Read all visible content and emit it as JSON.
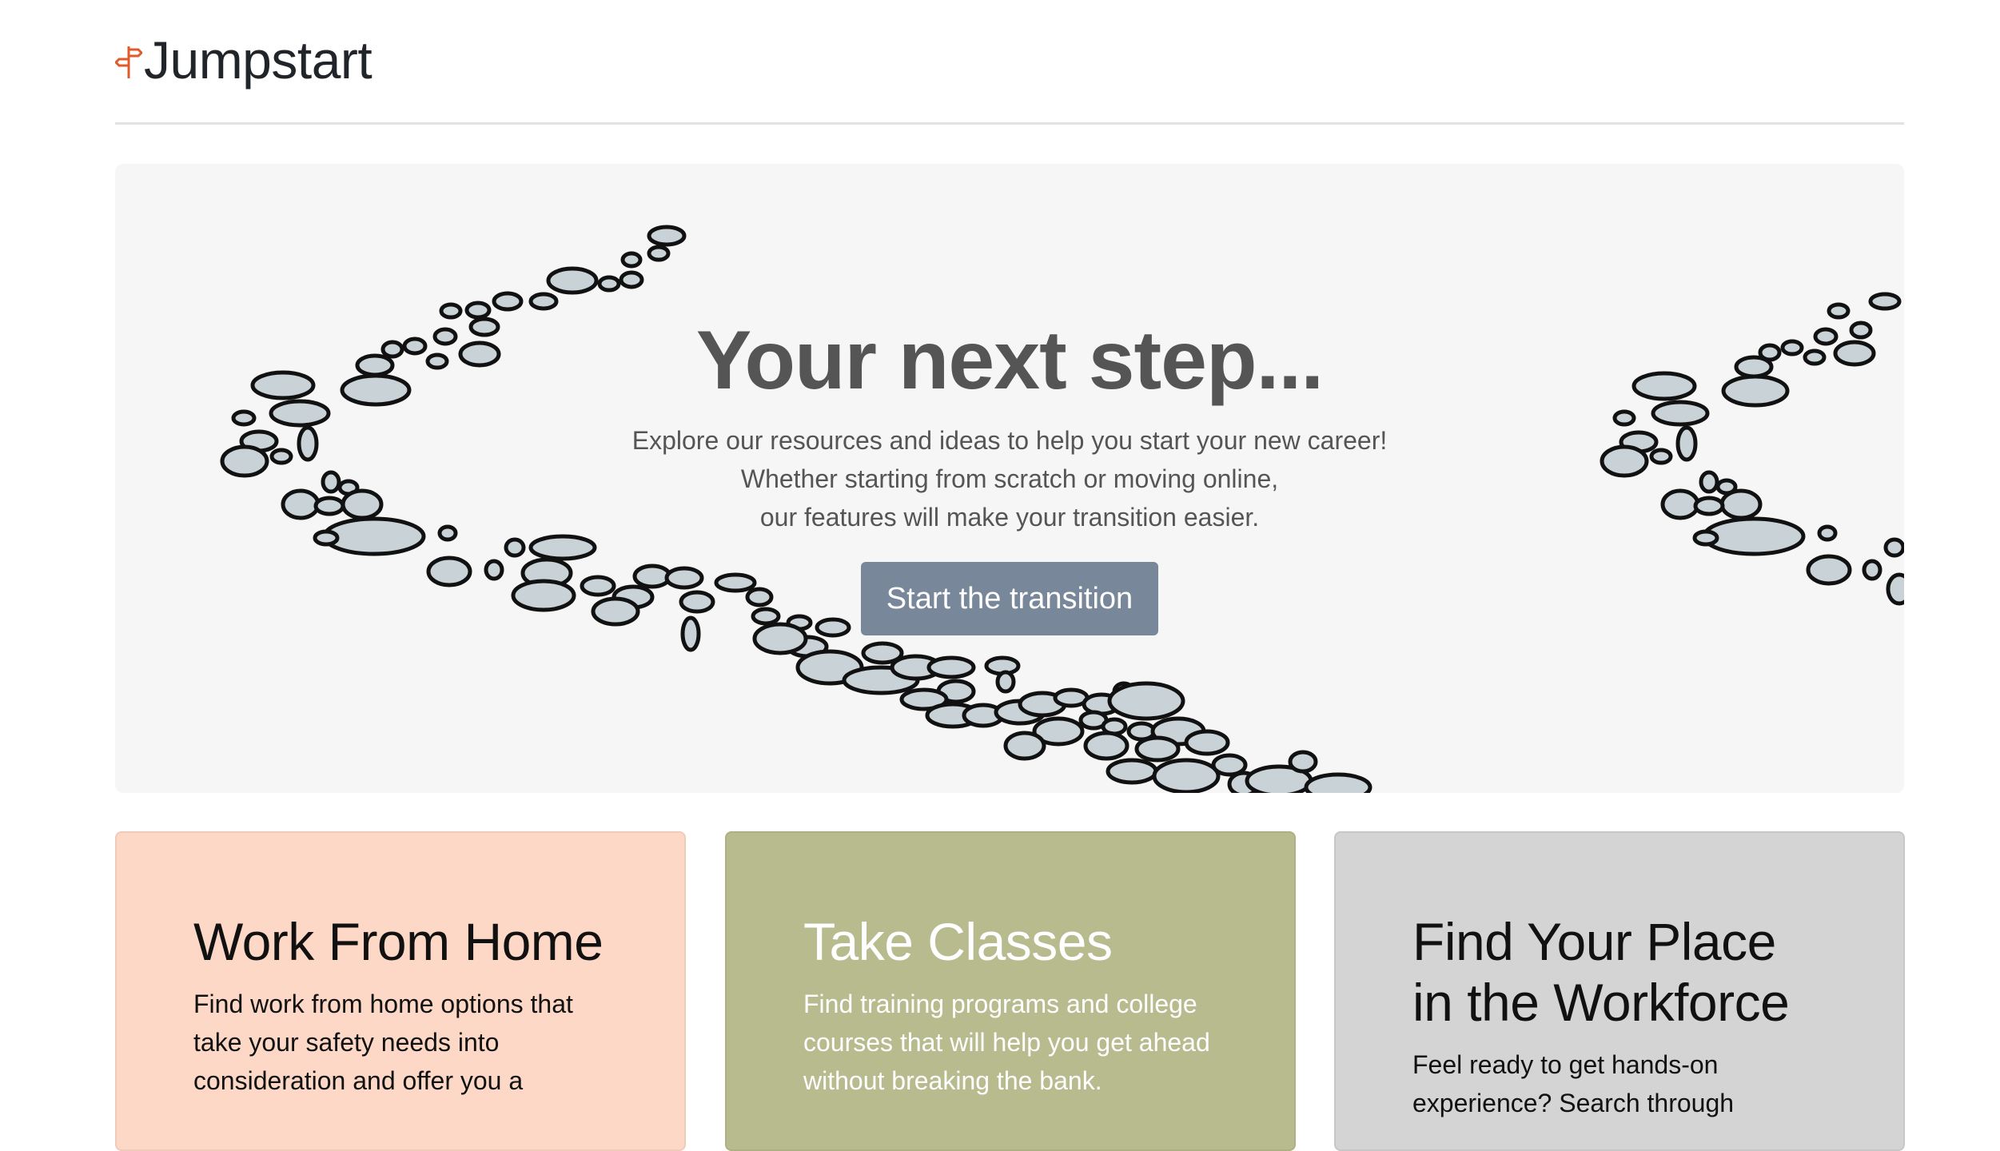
{
  "brand": {
    "name": "Jumpstart",
    "icon": "signpost-icon",
    "icon_color": "#e05a2b"
  },
  "hero": {
    "title": "Your next step...",
    "lead_lines": [
      "Explore our resources and ideas to help you start your new career!",
      "Whether starting from scratch or moving online,",
      "our features will make your transition easier."
    ],
    "button_label": "Start the transition",
    "background_image": "stepping-stones-path",
    "colors": {
      "title": "#555555",
      "button": "#78889a",
      "stone_fill": "#c9d3d7"
    }
  },
  "cards": [
    {
      "title": "Work From Home",
      "text": "Find work from home options that take your safety needs into consideration and offer you a",
      "color": "#fed8c6"
    },
    {
      "title": "Take Classes",
      "text": "Find training programs and college courses that will help you get ahead without breaking the bank.",
      "color": "#b8bb8e"
    },
    {
      "title": "Find Your Place in the Workforce",
      "text": "Feel ready to get hands-on experience? Search through",
      "color": "#d4d4d4"
    }
  ]
}
